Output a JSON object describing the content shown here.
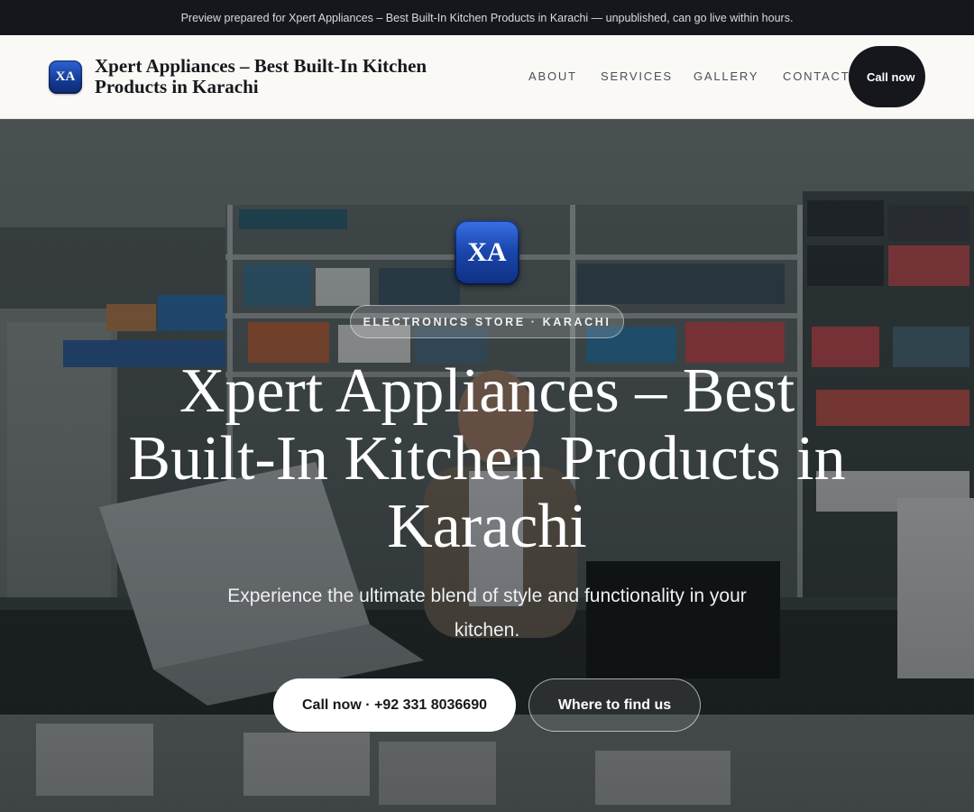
{
  "preview_banner": {
    "text": "Preview prepared for Xpert Appliances – Best Built-In Kitchen Products in Karachi — unpublished, can go live within hours."
  },
  "header": {
    "logo_text": "XA",
    "brand_name": "Xpert Appliances – Best Built-In Kitchen Products in Karachi",
    "nav": {
      "about": "ABOUT",
      "services": "SERVICES",
      "gallery": "GALLERY",
      "contact": "CONTACT"
    },
    "call_button": "Call now"
  },
  "hero": {
    "logo_text": "XA",
    "eyebrow": "ELECTRONICS STORE · KARACHI",
    "title": "Xpert Appliances – Best Built-In Kitchen Products in Karachi",
    "subtitle": "Experience the ultimate blend of style and functionality in your kitchen.",
    "primary_button": "Call now · +92 331 8036690",
    "secondary_button": "Where to find us"
  },
  "colors": {
    "dark": "#15171d",
    "header_bg": "#faf9f6",
    "logo_blue": "#1b48b0",
    "white": "#ffffff"
  }
}
